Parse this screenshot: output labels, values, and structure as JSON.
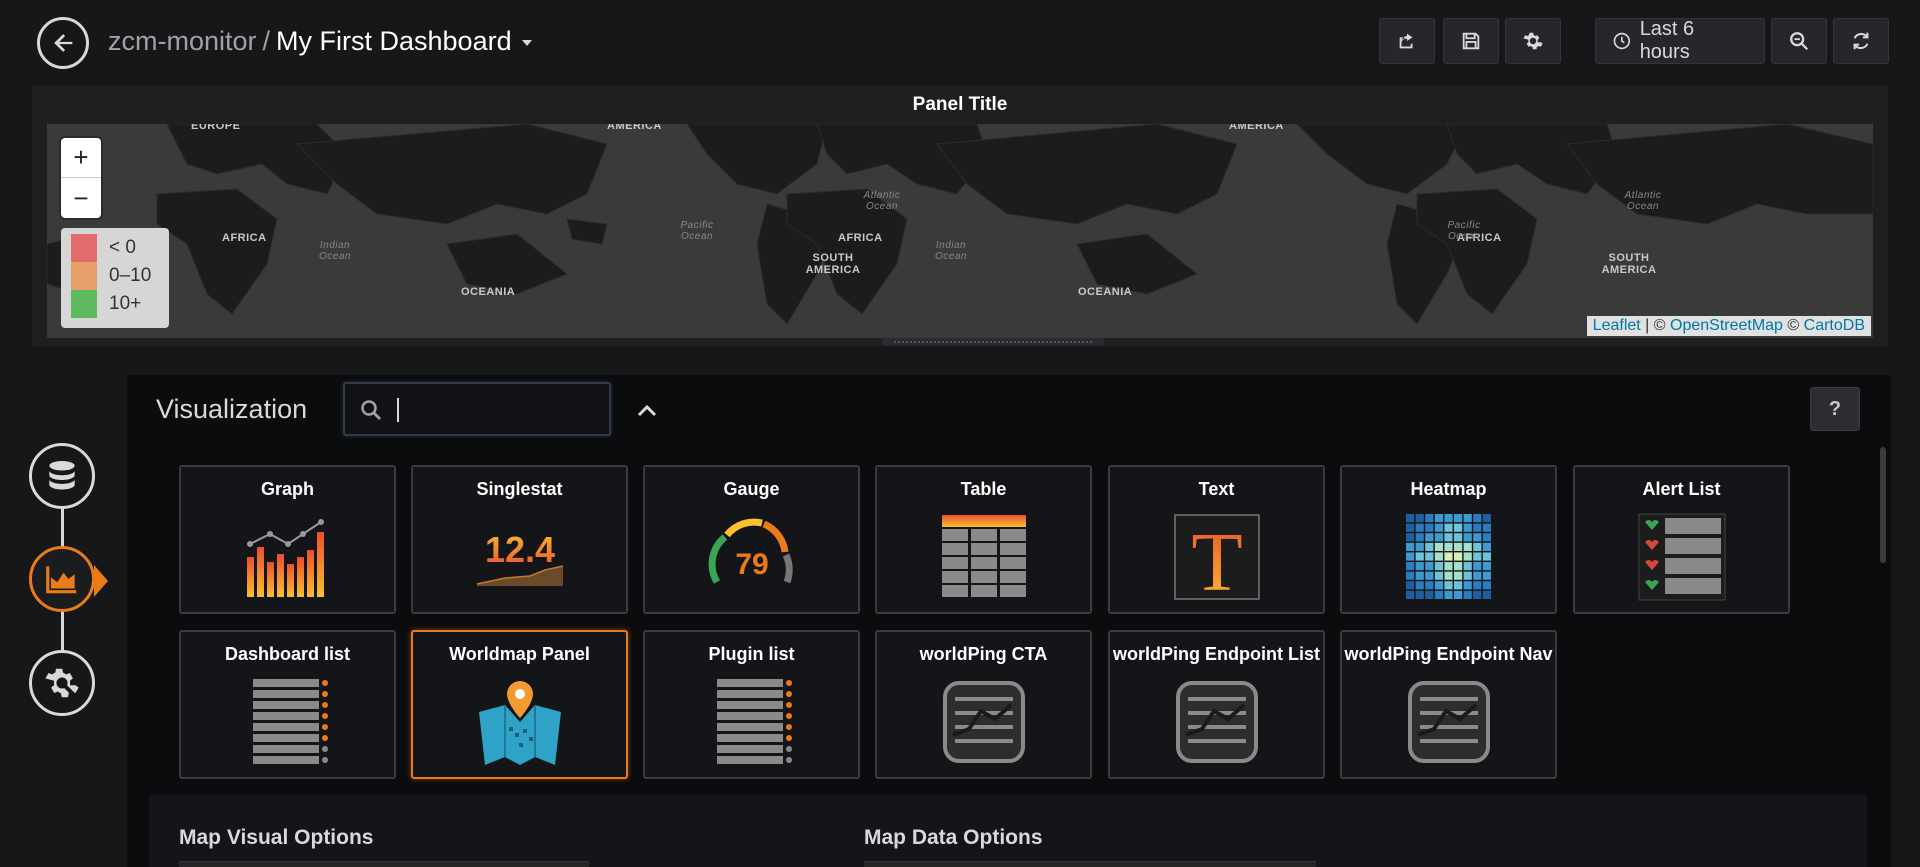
{
  "header": {
    "folder": "zcm-monitor",
    "separator": "/",
    "dashboard_title": "My First Dashboard",
    "time_range": "Last 6 hours"
  },
  "map_panel": {
    "title": "Panel Title",
    "zoom_in": "+",
    "zoom_out": "−",
    "legend": [
      {
        "label": "< 0",
        "color": "#e46b6b"
      },
      {
        "label": "0–10",
        "color": "#e8a06a"
      },
      {
        "label": "10+",
        "color": "#5fba5f"
      }
    ],
    "attribution": {
      "leaflet": "Leaflet",
      "sep1": " | © ",
      "osm": "OpenStreetMap",
      "sep2": " © ",
      "carto": "CartoDB"
    },
    "labels": {
      "europe": "EUROPE",
      "america": "AMERICA",
      "africa": "AFRICA",
      "indian_ocean": "Indian Ocean",
      "oceania": "OCEANIA",
      "pacific_ocean": "Pacific Ocean",
      "atlantic_ocean": "Atlantic Ocean",
      "south_america": "SOUTH AMERICA"
    }
  },
  "visualization": {
    "title": "Visualization",
    "search_value": "",
    "help": "?",
    "cards": [
      {
        "name": "Graph",
        "icon": "graph-icon"
      },
      {
        "name": "Singlestat",
        "icon": "singlestat-icon",
        "value": "12.4"
      },
      {
        "name": "Gauge",
        "icon": "gauge-icon",
        "value": "79"
      },
      {
        "name": "Table",
        "icon": "table-icon"
      },
      {
        "name": "Text",
        "icon": "text-icon",
        "glyph": "T"
      },
      {
        "name": "Heatmap",
        "icon": "heatmap-icon"
      },
      {
        "name": "Alert List",
        "icon": "alert-list-icon"
      },
      {
        "name": "Dashboard list",
        "icon": "dashboard-list-icon"
      },
      {
        "name": "Worldmap Panel",
        "icon": "worldmap-icon",
        "selected": true
      },
      {
        "name": "Plugin list",
        "icon": "plugin-list-icon"
      },
      {
        "name": "worldPing CTA",
        "icon": "worldping-icon"
      },
      {
        "name": "worldPing Endpoint List",
        "icon": "worldping-icon"
      },
      {
        "name": "worldPing Endpoint Nav",
        "icon": "worldping-icon"
      }
    ]
  },
  "options": {
    "map_visual": "Map Visual Options",
    "map_data": "Map Data Options"
  },
  "colors": {
    "accent": "#eb7b18",
    "background": "#161719",
    "panel": "#1f1f21"
  }
}
